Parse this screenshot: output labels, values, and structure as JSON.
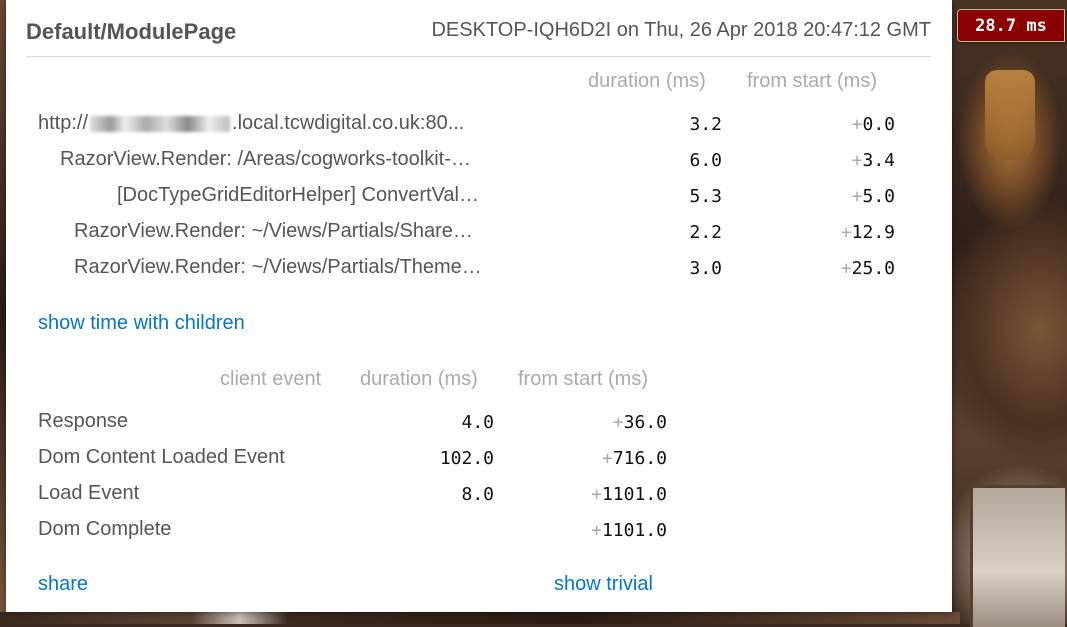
{
  "badge": {
    "total": "28.7 ms"
  },
  "header": {
    "title": "Default/ModulePage",
    "machine": "DESKTOP-IQH6D2I on Thu, 26 Apr 2018 20:47:12 GMT"
  },
  "timings": {
    "headers": {
      "duration": "duration (ms)",
      "from_start": "from start (ms)"
    },
    "rows": [
      {
        "name_prefix": "http://",
        "name_suffix": ".local.tcwdigital.co.uk:80...",
        "duration": "3.2",
        "from_start": "0.0"
      },
      {
        "name": "RazorView.Render: /Areas/cogworks-toolkit-…",
        "duration": "6.0",
        "from_start": "3.4"
      },
      {
        "name": "[DocTypeGridEditorHelper] ConvertVal…",
        "duration": "5.3",
        "from_start": "5.0"
      },
      {
        "name": "RazorView.Render: ~/Views/Partials/Share…",
        "duration": "2.2",
        "from_start": "12.9"
      },
      {
        "name": "RazorView.Render: ~/Views/Partials/Theme…",
        "duration": "3.0",
        "from_start": "25.0"
      }
    ]
  },
  "show_children_label": "show time with children",
  "client": {
    "headers": {
      "event": "client event",
      "duration": "duration (ms)",
      "from_start": "from start (ms)"
    },
    "rows": [
      {
        "name": "Response",
        "duration": "4.0",
        "from_start": "36.0"
      },
      {
        "name": "Dom Content Loaded Event",
        "duration": "102.0",
        "from_start": "716.0"
      },
      {
        "name": "Load Event",
        "duration": "8.0",
        "from_start": "1101.0"
      },
      {
        "name": "Dom Complete",
        "duration": "",
        "from_start": "1101.0"
      }
    ]
  },
  "footer": {
    "share_label": "share",
    "trivial_label": "show trivial"
  },
  "plus_sign": "+"
}
